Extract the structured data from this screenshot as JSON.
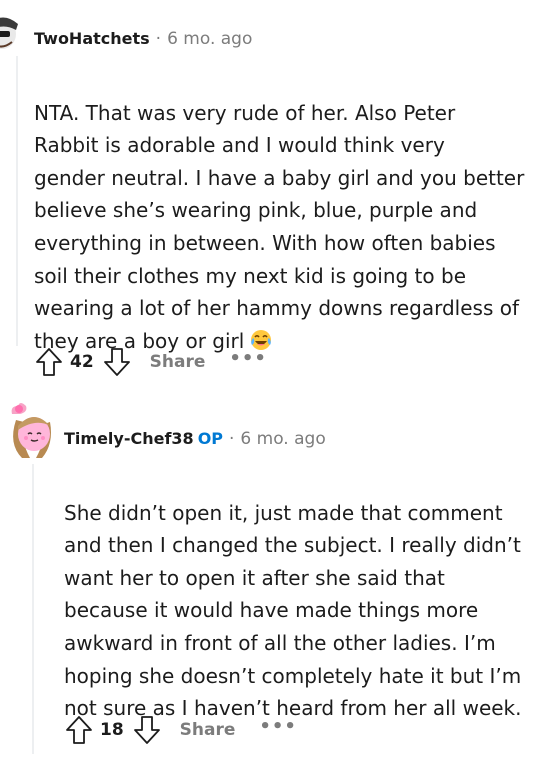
{
  "comments": [
    {
      "username": "TwoHatchets",
      "time": "6 mo. ago",
      "body": "NTA. That was very rude of her. Also Peter\nRabbit is adorable and I would think very\ngender neutral. I have a baby girl and you better\nbelieve she’s wearing pink, blue, purple and\neverything in between. With how often babies\nsoil their clothes my next kid is going to be\nwearing a lot of her hammy downs regardless of\nthey are a boy or girl",
      "emoji": "tears-of-joy-emoji",
      "score": "42",
      "share_label": "Share",
      "more_label": "•••"
    },
    {
      "username": "Timely-Chef38",
      "op_badge": "OP",
      "time": "6 mo. ago",
      "body": "She didn’t open it, just made that comment\nand then I changed the subject. I really didn’t\nwant her to open it after she said that\nbecause it would have made things more\nawkward in front of all the other ladies. I’m\nhoping she doesn’t completely hate it but I’m\nnot sure as I haven’t heard from her all week.",
      "score": "18",
      "share_label": "Share",
      "more_label": "•••"
    }
  ],
  "meta_separator": "·",
  "colors": {
    "op": "#0079d3",
    "muted": "#7c7c7c",
    "text": "#1c1c1c"
  }
}
